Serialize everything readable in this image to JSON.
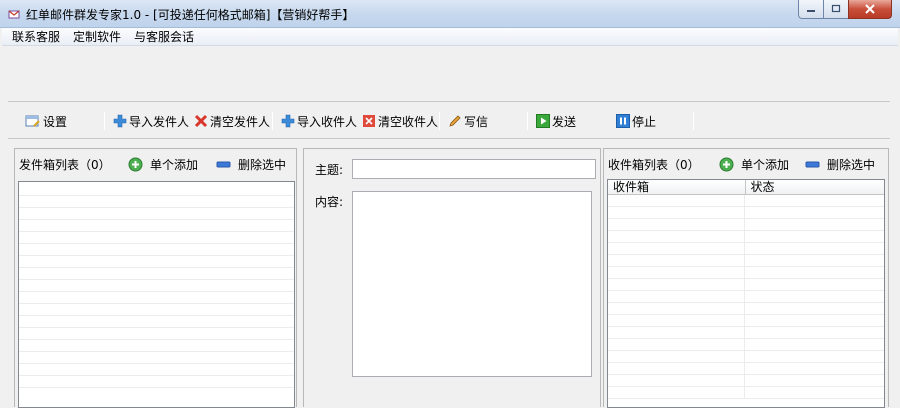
{
  "window": {
    "title": "红单邮件群发专家1.0 - [可投递任何格式邮箱]【营销好帮手】",
    "app_icon": "mail-app-icon"
  },
  "menu": {
    "items": [
      {
        "label": "联系客服"
      },
      {
        "label": "定制软件"
      },
      {
        "label": "与客服会话"
      }
    ]
  },
  "toolbar": {
    "settings": {
      "label": "设置",
      "icon": "settings-icon"
    },
    "import_senders": {
      "label": "导入发件人",
      "icon": "plus-icon"
    },
    "clear_senders": {
      "label": "清空发件人",
      "icon": "red-x-icon"
    },
    "import_recipients": {
      "label": "导入收件人",
      "icon": "plus-icon"
    },
    "clear_recipients": {
      "label": "清空收件人",
      "icon": "red-x-icon"
    },
    "compose": {
      "label": "写信",
      "icon": "pencil-icon"
    },
    "send": {
      "label": "发送",
      "icon": "play-icon"
    },
    "stop": {
      "label": "停止",
      "icon": "pause-icon"
    }
  },
  "sender_panel": {
    "title": "发件箱列表（0）",
    "add_label": "单个添加",
    "delete_label": "删除选中"
  },
  "compose_panel": {
    "subject_label": "主题:",
    "subject_value": "",
    "content_label": "内容:",
    "content_value": ""
  },
  "recipient_panel": {
    "title": "收件箱列表（0）",
    "add_label": "单个添加",
    "delete_label": "删除选中",
    "columns": [
      "收件箱",
      "状态"
    ]
  },
  "colors": {
    "add_green": "#4caf50",
    "delete_blue": "#3c78d8",
    "clear_red": "#d9362b",
    "send_green": "#3aa83a",
    "stop_blue": "#2f7fd6"
  }
}
